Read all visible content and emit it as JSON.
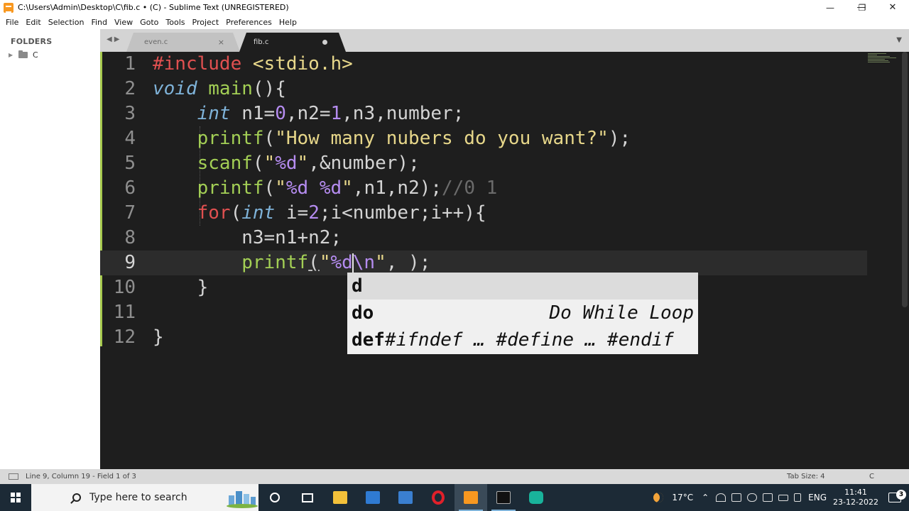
{
  "window": {
    "title": "C:\\Users\\Admin\\Desktop\\C\\fib.c • (C) - Sublime Text (UNREGISTERED)",
    "minimize_glyph": "—",
    "maximize_glyph": "❐",
    "close_glyph": "✕"
  },
  "menu": [
    "File",
    "Edit",
    "Selection",
    "Find",
    "View",
    "Goto",
    "Tools",
    "Project",
    "Preferences",
    "Help"
  ],
  "sidebar": {
    "header": "FOLDERS",
    "items": [
      {
        "label": "C",
        "icon": "folder-icon",
        "expand_glyph": "▶"
      }
    ]
  },
  "tabs": [
    {
      "label": "even.c",
      "active": false,
      "close_glyph": "×"
    },
    {
      "label": "fib.c",
      "active": true,
      "dirty": true
    }
  ],
  "tabbar": {
    "nav_glyph": "◀▶",
    "dropdown_glyph": "▼"
  },
  "editor": {
    "current_line": 9,
    "line_numbers": [
      "1",
      "2",
      "3",
      "4",
      "5",
      "6",
      "7",
      "8",
      "9",
      "10",
      "11",
      "12"
    ],
    "lines": [
      "#include <stdio.h>",
      "void main(){",
      "    int n1=0,n2=1,n3,number;",
      "    printf(\"How many nubers do you want?\");",
      "    scanf(\"%d\",&number);",
      "    printf(\"%d %d\",n1,n2);//0 1",
      "    for(int i=2;i<number;i++){",
      "        n3=n1+n2;",
      "        printf(\"%d\\n\", );",
      "    }",
      "",
      "}"
    ]
  },
  "autocomplete": {
    "items": [
      {
        "trigger": "d",
        "desc": ""
      },
      {
        "trigger": "do",
        "desc": "Do While Loop"
      },
      {
        "trigger": "def",
        "desc": "#ifndef … #define … #endif"
      }
    ]
  },
  "statusbar": {
    "position": "Line 9, Column 19 - Field 1 of 3",
    "tab_size": "Tab Size: 4",
    "syntax": "C"
  },
  "taskbar": {
    "search_placeholder": "Type here to search",
    "apps": [
      "task-view-icon",
      "file-explorer-icon",
      "mail-icon",
      "store-icon",
      "opera-icon",
      "sublime-text-icon",
      "terminal-icon",
      "snipping-tool-icon"
    ],
    "weather": "17°C",
    "language": "ENG",
    "time": "11:41",
    "date": "23-12-2022",
    "notification_count": "3"
  },
  "colors": {
    "editor_bg": "#1e1e1e",
    "keyword": "#e05050",
    "type_keyword": "#7fb3d9",
    "function": "#a3cf55",
    "number": "#b58cf0",
    "string": "#e7d78a",
    "comment": "#6b6b6b",
    "gutter_marker": "#a6c94e"
  }
}
